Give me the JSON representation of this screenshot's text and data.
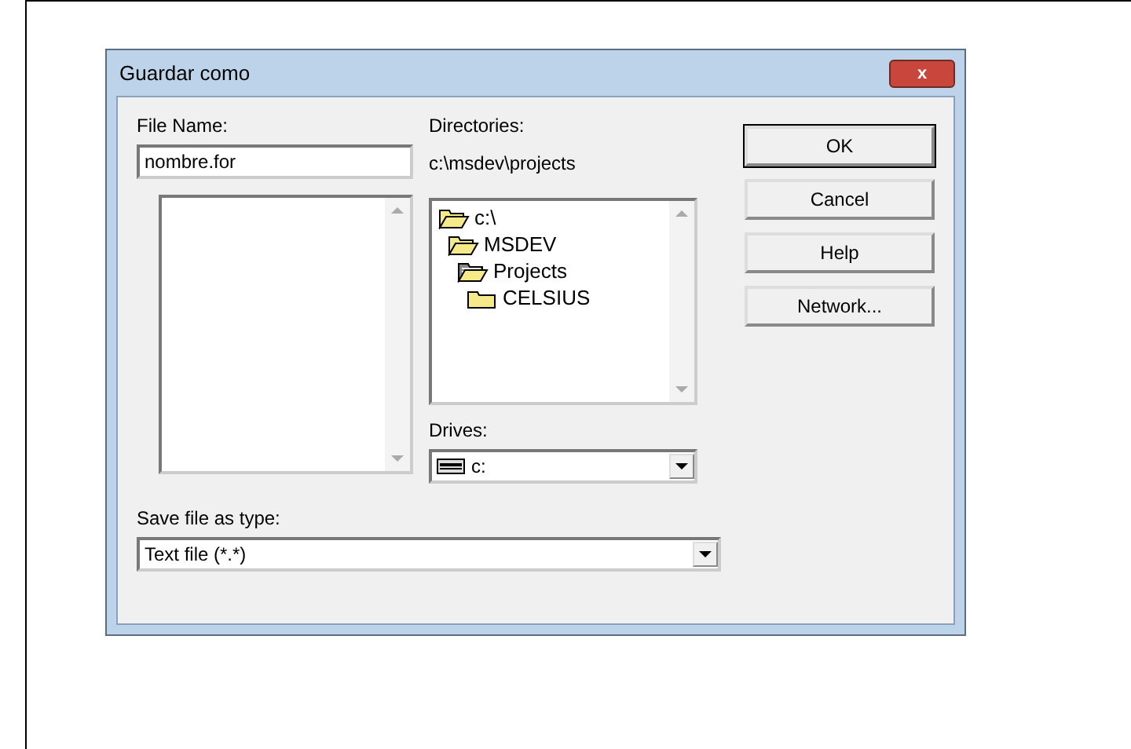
{
  "window": {
    "title": "Guardar como",
    "close_label": "x"
  },
  "file_name": {
    "label": "File Name:",
    "value": "nombre.for"
  },
  "directories": {
    "label": "Directories:",
    "path": "c:\\msdev\\projects",
    "tree": [
      {
        "name": "c:\\",
        "kind": "open",
        "children": [
          {
            "name": "MSDEV",
            "kind": "open",
            "children": [
              {
                "name": "Projects",
                "kind": "current",
                "children": [
                  {
                    "name": "CELSIUS",
                    "kind": "closed"
                  }
                ]
              }
            ]
          }
        ]
      }
    ]
  },
  "drives": {
    "label": "Drives:",
    "value": "c:"
  },
  "save_type": {
    "label": "Save file as type:",
    "value": "Text file (*.*)"
  },
  "buttons": [
    "OK",
    "Cancel",
    "Help",
    "Network..."
  ]
}
